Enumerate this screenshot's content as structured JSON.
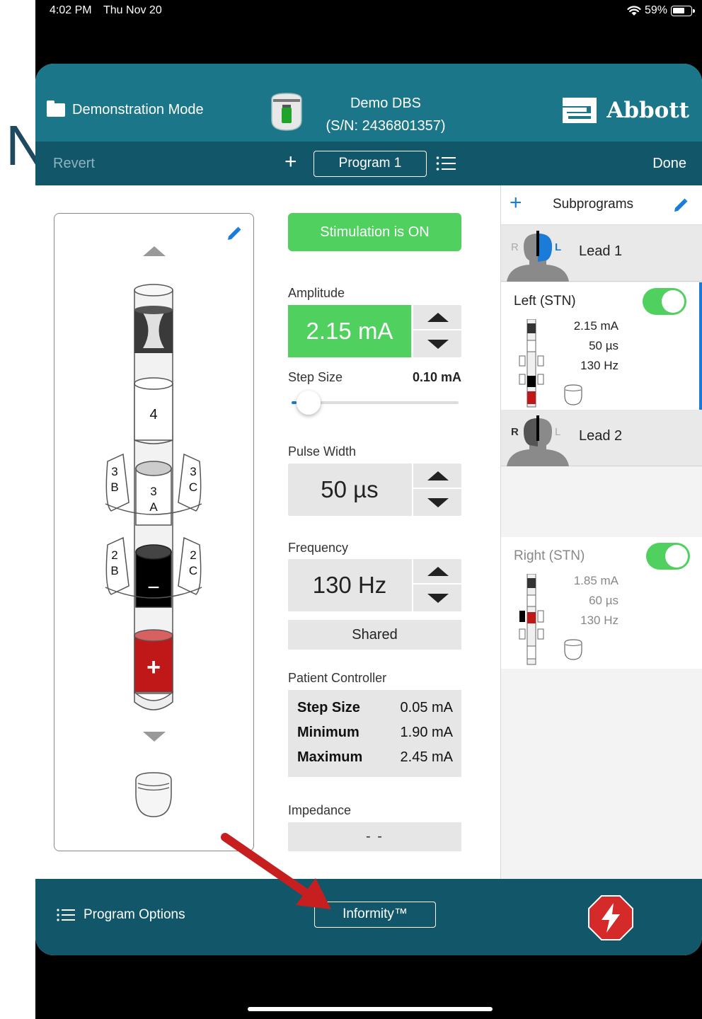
{
  "status_bar": {
    "time": "4:02 PM",
    "date": "Thu Nov 20",
    "battery": "59%"
  },
  "background_letter": "N",
  "header": {
    "mode_label": "Demonstration Mode",
    "device_name": "Demo DBS",
    "device_serial": "(S/N: 2436801357)",
    "brand": "Abbott"
  },
  "toolbar": {
    "revert": "Revert",
    "add": "+",
    "program": "Program 1",
    "done": "Done"
  },
  "lead_diagram": {
    "contacts": {
      "c4": "4",
      "c3b": [
        "3",
        "B"
      ],
      "c3a": [
        "3",
        "A"
      ],
      "c3c": [
        "3",
        "C"
      ],
      "c2b": [
        "2",
        "B"
      ],
      "c2c": [
        "2",
        "C"
      ],
      "c2a": "−",
      "c1": "+"
    }
  },
  "stimulation": {
    "label": "Stimulation is ON",
    "color": "#4fd05f"
  },
  "amplitude": {
    "label": "Amplitude",
    "value": "2.15 mA"
  },
  "step_size": {
    "label": "Step Size",
    "value": "0.10 mA",
    "slider_fraction": 0.03
  },
  "pulse_width": {
    "label": "Pulse Width",
    "value": "50 µs"
  },
  "frequency": {
    "label": "Frequency",
    "value": "130 Hz",
    "shared": "Shared"
  },
  "patient_controller": {
    "label": "Patient Controller",
    "rows": [
      {
        "k": "Step Size",
        "v": "0.05 mA"
      },
      {
        "k": "Minimum",
        "v": "1.90 mA"
      },
      {
        "k": "Maximum",
        "v": "2.45 mA"
      }
    ]
  },
  "impedance": {
    "label": "Impedance",
    "value": "- -"
  },
  "subprograms": {
    "title": "Subprograms",
    "leads": [
      {
        "name": "Lead 1",
        "r": "R",
        "l": "L",
        "sub_title": "Left (STN)",
        "enabled": true,
        "amp": "2.15 mA",
        "pw": "50 µs",
        "freq": "130 Hz"
      },
      {
        "name": "Lead 2",
        "r": "R",
        "l": "L",
        "sub_title": "Right (STN)",
        "enabled": true,
        "amp": "1.85 mA",
        "pw": "60 µs",
        "freq": "130 Hz"
      }
    ]
  },
  "footer": {
    "program_options": "Program Options",
    "informity": "Informity™"
  },
  "colors": {
    "header": "#1b7689",
    "subbar": "#12566a",
    "accent": "#1a7bd8",
    "on": "#4fd05f",
    "anode": "#c01818",
    "stop": "#d42a2a"
  }
}
